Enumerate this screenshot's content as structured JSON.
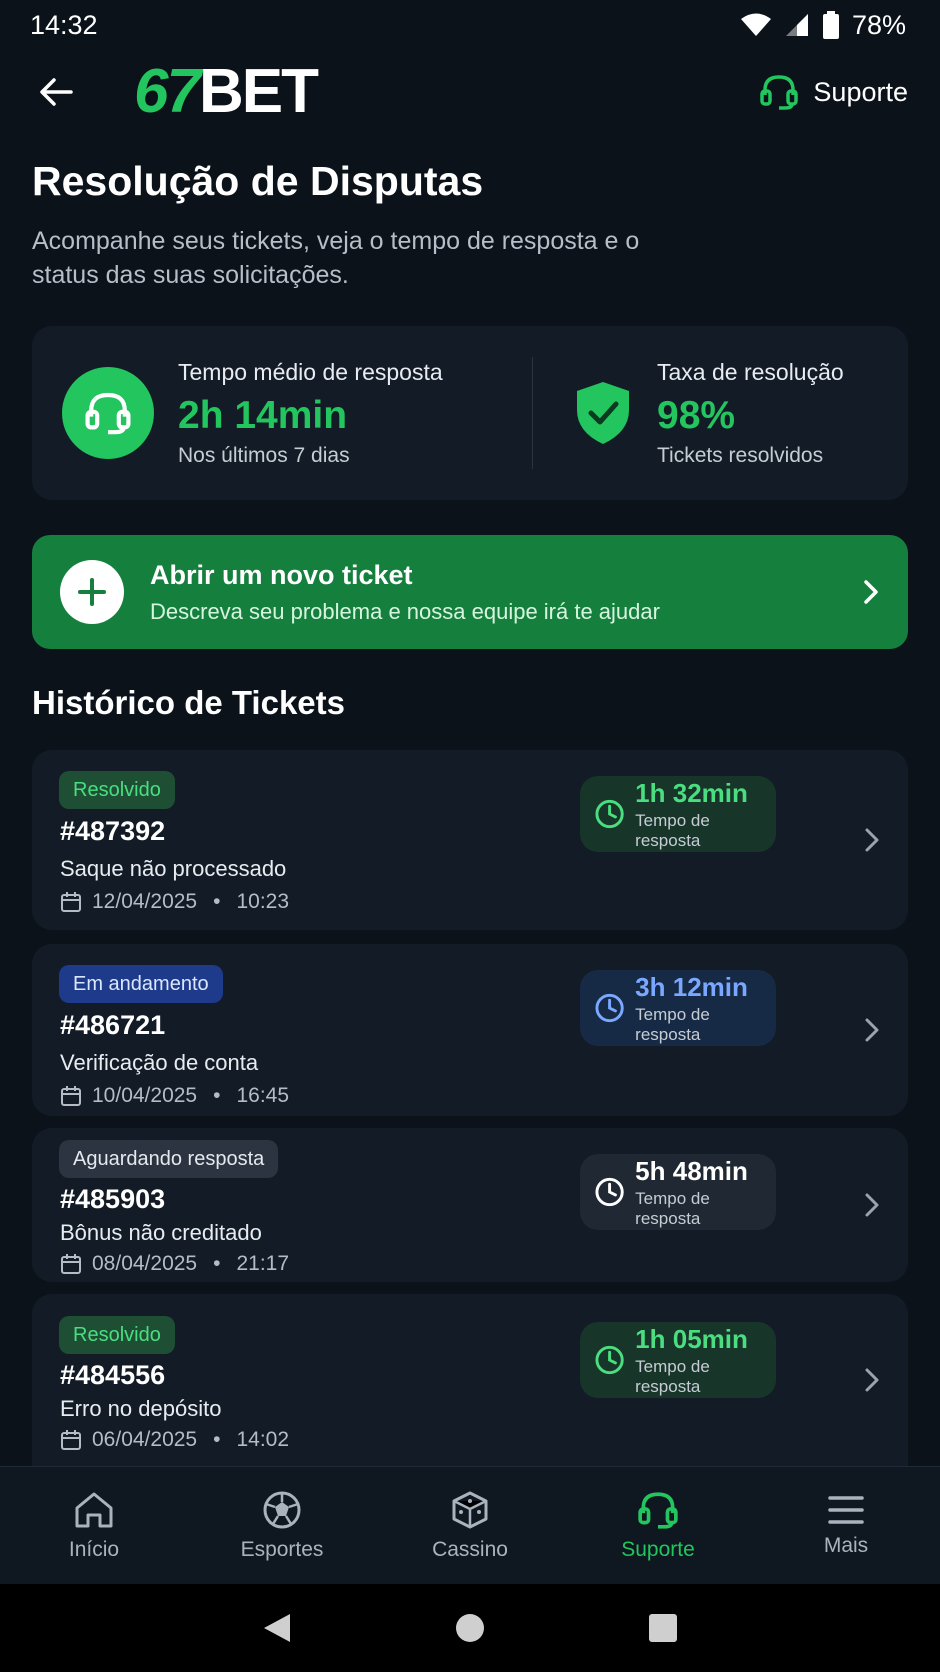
{
  "status_bar": {
    "time": "14:32",
    "battery": "78%"
  },
  "header": {
    "logo_green": "67",
    "logo_white": "BET",
    "support_label": "Suporte"
  },
  "page": {
    "title": "Resolução de Disputas",
    "subtitle": "Acompanhe seus tickets, veja o tempo de resposta e o status das suas solicitações."
  },
  "stats": {
    "response": {
      "label": "Tempo médio de resposta",
      "value": "2h 14min",
      "note": "Nos últimos 7 dias"
    },
    "resolution": {
      "label": "Taxa de resolução",
      "value": "98%",
      "note": "Tickets resolvidos"
    }
  },
  "new_ticket": {
    "title": "Abrir um novo ticket",
    "subtitle": "Descreva seu problema e nossa equipe irá te ajudar"
  },
  "history_title": "Histórico de Tickets",
  "tickets": [
    {
      "status": "Resolvido",
      "id": "#487392",
      "subject": "Saque não processado",
      "date": "12/04/2025",
      "time": "10:23",
      "response_time": "1h 32min",
      "response_label": "Tempo de resposta"
    },
    {
      "status": "Em andamento",
      "id": "#486721",
      "subject": "Verificação de conta",
      "date": "10/04/2025",
      "time": "16:45",
      "response_time": "3h 12min",
      "response_label": "Tempo de resposta"
    },
    {
      "status": "Aguardando resposta",
      "id": "#485903",
      "subject": "Bônus não creditado",
      "date": "08/04/2025",
      "time": "21:17",
      "response_time": "5h 48min",
      "response_label": "Tempo de resposta"
    },
    {
      "status": "Resolvido",
      "id": "#484556",
      "subject": "Erro no depósito",
      "date": "06/04/2025",
      "time": "14:02",
      "response_time": "1h 05min",
      "response_label": "Tempo de resposta"
    }
  ],
  "bottom_nav": [
    {
      "label": "Início",
      "icon": "home-icon"
    },
    {
      "label": "Esportes",
      "icon": "soccer-ball-icon"
    },
    {
      "label": "Cassino",
      "icon": "dice-icon"
    },
    {
      "label": "Suporte",
      "icon": "headset-icon",
      "active": true
    },
    {
      "label": "Mais",
      "icon": "menu-icon"
    }
  ],
  "colors": {
    "accent": "#22c55e",
    "background": "#0b121a",
    "card": "#131c26",
    "cta": "#15803d"
  }
}
